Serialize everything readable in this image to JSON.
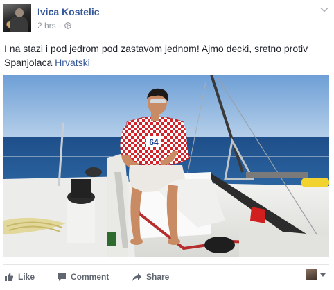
{
  "post": {
    "author": "Ivica Kostelic",
    "time": "2 hrs",
    "separator": "·",
    "text": "I na stazi i pod jedrom pod zastavom jednom! Ajmo decki, sretno protiv Spanjolaca",
    "link_text": "Hrvatski",
    "trailing_glyphs": "",
    "photo_jersey_number": "64"
  },
  "actions": {
    "like": "Like",
    "comment": "Comment",
    "share": "Share"
  },
  "icons": {
    "globe": "globe-icon",
    "menu": "chevron-down-icon",
    "like": "thumbs-up-icon",
    "comment": "speech-bubble-icon",
    "share": "share-arrow-icon",
    "viewer_menu": "caret-down-icon"
  },
  "colors": {
    "link": "#365899",
    "meta": "#90949c",
    "action": "#616770"
  }
}
